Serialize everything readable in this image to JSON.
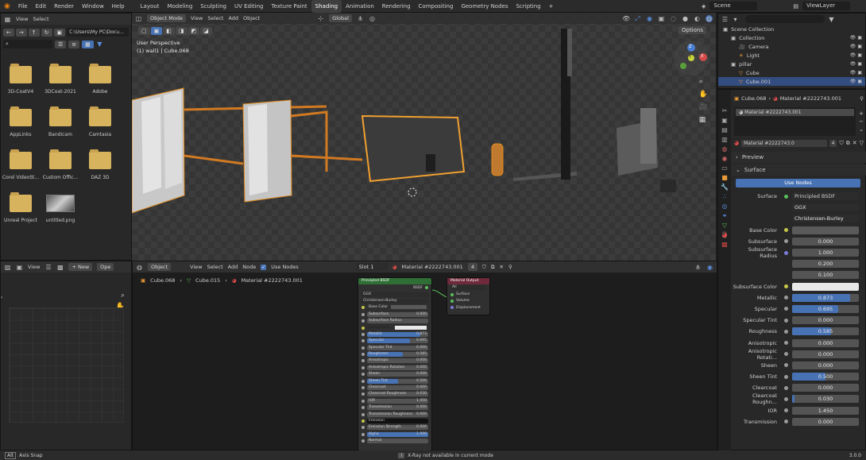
{
  "topmenu": [
    "File",
    "Edit",
    "Render",
    "Window",
    "Help"
  ],
  "workspaces": [
    "Layout",
    "Modeling",
    "Sculpting",
    "UV Editing",
    "Texture Paint",
    "Shading",
    "Animation",
    "Rendering",
    "Compositing",
    "Geometry Nodes",
    "Scripting"
  ],
  "active_workspace": "Shading",
  "scene": "Scene",
  "viewlayer": "ViewLayer",
  "filebrowser": {
    "view": "View",
    "select": "Select",
    "path": "C:\\Users\\My PC\\Docu...",
    "items": [
      "3D-CoatV4",
      "3DCoat-2021",
      "Adobe",
      "AppLinks",
      "Bandicam",
      "Camtasia",
      "Corel VideoSt...",
      "Custom Offic...",
      "DAZ 3D",
      "Unreal Project",
      "untitled.png"
    ]
  },
  "viewport": {
    "mode": "Object Mode",
    "menus": [
      "View",
      "Select",
      "Add",
      "Object"
    ],
    "orientation": "Global",
    "label1": "User Perspective",
    "label2": "(1) wall1 | Cube.068",
    "options": "Options",
    "gizmo": {
      "x": "X",
      "y": "Y",
      "z": "Z"
    }
  },
  "image_editor": {
    "view": "View",
    "new": "New",
    "open": "Ope"
  },
  "node_editor": {
    "mode": "Object",
    "menus": [
      "View",
      "Select",
      "Add",
      "Node"
    ],
    "use_nodes": "Use Nodes",
    "slot": "Slot 1",
    "material": "Material #2222743.001",
    "users": "4",
    "breadcrumb": [
      "Cube.068",
      "Cube.015",
      "Material #2222743.001"
    ]
  },
  "bsdf_node": {
    "title": "Principled BSDF",
    "out": "BSDF",
    "dist": "GGX",
    "sss": "Christensen-Burley",
    "rows": [
      [
        "Base Color",
        ""
      ],
      [
        "Subsurface",
        "0.000"
      ],
      [
        "Subsurface Radius",
        ""
      ],
      [
        "Subsurface Co...",
        ""
      ],
      [
        "Metallic",
        "0.873"
      ],
      [
        "Specular",
        "0.695"
      ],
      [
        "Specular Tint",
        "0.000"
      ],
      [
        "Roughness",
        "0.585"
      ],
      [
        "Anisotropic",
        "0.000"
      ],
      [
        "Anisotropic Rotation",
        "0.000"
      ],
      [
        "Sheen",
        "0.000"
      ],
      [
        "Sheen Tint",
        "0.500"
      ],
      [
        "Clearcoat",
        "0.000"
      ],
      [
        "Clearcoat Roughness",
        "0.030"
      ],
      [
        "IOR",
        "1.450"
      ],
      [
        "Transmission",
        "0.000"
      ],
      [
        "Transmission Roughness",
        "0.000"
      ],
      [
        "Emission",
        ""
      ],
      [
        "Emission Strength",
        "0.000"
      ],
      [
        "Alpha",
        "1.000"
      ],
      [
        "Normal",
        ""
      ]
    ]
  },
  "output_node": {
    "title": "Material Output",
    "target": "All",
    "inputs": [
      "Surface",
      "Volume",
      "Displacement"
    ]
  },
  "outliner": {
    "items": [
      {
        "name": "Scene Collection",
        "depth": 0
      },
      {
        "name": "Collection",
        "depth": 1
      },
      {
        "name": "Camera",
        "depth": 2
      },
      {
        "name": "Light",
        "depth": 2
      },
      {
        "name": "pillar",
        "depth": 1
      },
      {
        "name": "Cube",
        "depth": 2
      },
      {
        "name": "Cube.001",
        "depth": 2
      }
    ]
  },
  "properties": {
    "object": "Cube.068",
    "material": "Material #2222743.001",
    "slot_item": "Material #2222743.001",
    "mat_field": "Material #2222743.0",
    "users": "4",
    "preview": "Preview",
    "surface_panel": "Surface",
    "use_nodes": "Use Nodes",
    "surface_label": "Surface",
    "surface_value": "Principled BSDF",
    "distribution": "GGX",
    "subsurface_method": "Christensen-Burley",
    "rows": [
      {
        "label": "Base Color",
        "type": "color",
        "value": "",
        "color": "#5a5a5a"
      },
      {
        "label": "Subsurface",
        "type": "num",
        "value": "0.000",
        "fill": 0
      },
      {
        "label": "Subsurface Radius",
        "type": "num",
        "value": "1.000",
        "fill": 0
      },
      {
        "label": "",
        "type": "num",
        "value": "0.200",
        "fill": 0
      },
      {
        "label": "",
        "type": "num",
        "value": "0.100",
        "fill": 0
      },
      {
        "label": "Subsurface Color",
        "type": "color",
        "value": "",
        "color": "#e8e8e8"
      },
      {
        "label": "Metallic",
        "type": "num",
        "value": "0.873",
        "fill": 0.873
      },
      {
        "label": "Specular",
        "type": "num",
        "value": "0.695",
        "fill": 0.695
      },
      {
        "label": "Specular Tint",
        "type": "num",
        "value": "0.000",
        "fill": 0
      },
      {
        "label": "Roughness",
        "type": "num",
        "value": "0.585",
        "fill": 0.585
      },
      {
        "label": "Anisotropic",
        "type": "num",
        "value": "0.000",
        "fill": 0
      },
      {
        "label": "Anisotropic Rotati...",
        "type": "num",
        "value": "0.000",
        "fill": 0
      },
      {
        "label": "Sheen",
        "type": "num",
        "value": "0.000",
        "fill": 0
      },
      {
        "label": "Sheen Tint",
        "type": "num",
        "value": "0.500",
        "fill": 0.5
      },
      {
        "label": "Clearcoat",
        "type": "num",
        "value": "0.000",
        "fill": 0
      },
      {
        "label": "Clearcoat Roughn...",
        "type": "num",
        "value": "0.030",
        "fill": 0.03
      },
      {
        "label": "IOR",
        "type": "num",
        "value": "1.450",
        "fill": 0
      },
      {
        "label": "Transmission",
        "type": "num",
        "value": "0.000",
        "fill": 0
      }
    ]
  },
  "status": {
    "left": "Axis Snap",
    "center": "X-Ray not available in current mode",
    "right": "3.0.0"
  },
  "colors": {
    "accent": "#4772b3",
    "selection_orange": "#e08a1e"
  }
}
